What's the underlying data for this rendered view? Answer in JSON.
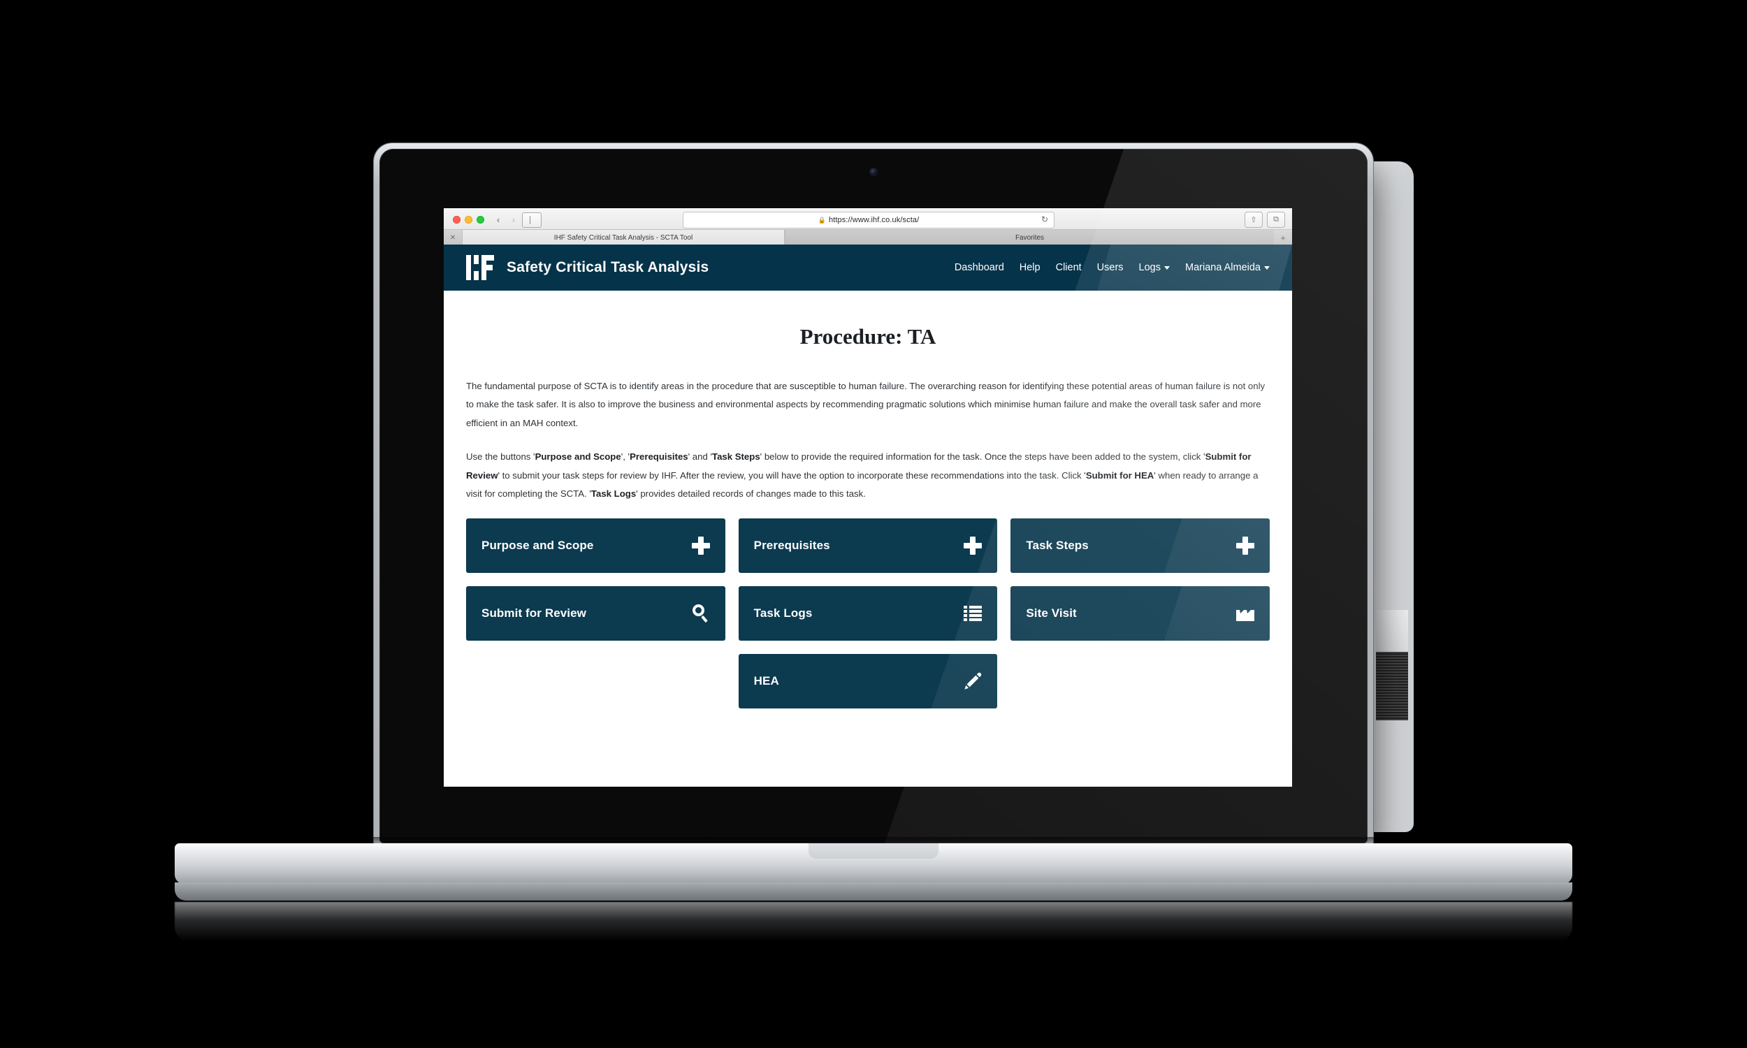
{
  "browser": {
    "url": "https://www.ihf.co.uk/scta/",
    "lock_glyph": "\u0001f512",
    "tab_title": "IHF Safety Critical Task Analysis  - SCTA Tool",
    "favorites_label": "Favorites",
    "back_glyph": "‹",
    "forward_glyph": "›",
    "reload_glyph": "↻",
    "close_tab_glyph": "✕",
    "new_tab_glyph": "+",
    "share_glyph": "⇧",
    "tabs_glyph": "⧉"
  },
  "header": {
    "brand_title": "Safety Critical Task Analysis",
    "logo_name": "IHF",
    "nav": [
      {
        "label": "Dashboard",
        "dropdown": false
      },
      {
        "label": "Help",
        "dropdown": false
      },
      {
        "label": "Client",
        "dropdown": false
      },
      {
        "label": "Users",
        "dropdown": false
      },
      {
        "label": "Logs",
        "dropdown": true
      },
      {
        "label": "Mariana Almeida",
        "dropdown": true
      }
    ]
  },
  "main": {
    "page_title": "Procedure: TA",
    "paragraph_1": "The fundamental purpose of SCTA is to identify areas in the procedure that are susceptible to human failure. The overarching reason for identifying these potential areas of human failure is not only to make the task safer. It is also to improve the business and environmental aspects by recommending pragmatic solutions which minimise human failure and make the overall task safer and more efficient in an MAH context.",
    "paragraph_2_parts": [
      {
        "text": "Use the buttons '",
        "bold": false
      },
      {
        "text": "Purpose and Scope",
        "bold": true
      },
      {
        "text": "', '",
        "bold": false
      },
      {
        "text": "Prerequisites",
        "bold": true
      },
      {
        "text": "' and '",
        "bold": false
      },
      {
        "text": "Task Steps",
        "bold": true
      },
      {
        "text": "' below to provide the required information for the task. Once the steps have been added to the system, click '",
        "bold": false
      },
      {
        "text": "Submit for Review",
        "bold": true
      },
      {
        "text": "' to submit your task steps for review by IHF. After the review, you will have the option to incorporate these recommendations into the task. Click '",
        "bold": false
      },
      {
        "text": "Submit for HEA",
        "bold": true
      },
      {
        "text": "' when ready to arrange a visit for completing the SCTA. '",
        "bold": false
      },
      {
        "text": "Task Logs",
        "bold": true
      },
      {
        "text": "' provides detailed records of changes made to this task.",
        "bold": false
      }
    ],
    "tiles": [
      {
        "label": "Purpose and Scope",
        "icon": "plus-icon"
      },
      {
        "label": "Prerequisites",
        "icon": "plus-icon"
      },
      {
        "label": "Task Steps",
        "icon": "plus-icon"
      },
      {
        "label": "Submit for Review",
        "icon": "search-icon"
      },
      {
        "label": "Task Logs",
        "icon": "list-icon"
      },
      {
        "label": "Site Visit",
        "icon": "factory-icon"
      },
      {
        "label": "HEA",
        "icon": "pencil-icon"
      }
    ]
  },
  "colors": {
    "header_bg": "#05334a",
    "tile_bg": "#0c3a4f",
    "tile_text": "#ffffff",
    "page_bg": "#ffffff",
    "body_text": "#2f3337"
  }
}
